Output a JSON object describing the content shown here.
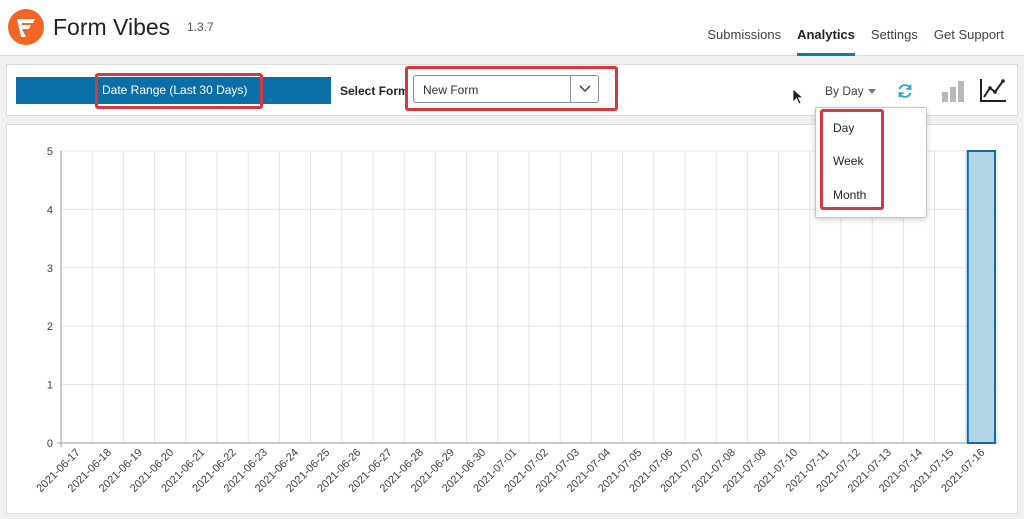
{
  "app": {
    "title": "Form Vibes",
    "version": "1.3.7",
    "logo_icon": "form-vibes-logo-icon",
    "brand_color": "#f26522"
  },
  "nav": {
    "tabs": [
      {
        "label": "Submissions",
        "active": false
      },
      {
        "label": "Analytics",
        "active": true
      },
      {
        "label": "Settings",
        "active": false
      },
      {
        "label": "Get Support",
        "active": false
      }
    ]
  },
  "toolbar": {
    "date_range_label": "Date Range (Last 30 Days)",
    "select_form_label": "Select Form",
    "form_value": "New Form",
    "group_by_label": "By Day",
    "accent_color": "#0b6ea6",
    "highlight_color": "#d7373f"
  },
  "dropdown": {
    "options": [
      "Day",
      "Week",
      "Month"
    ]
  },
  "chart_data": {
    "type": "bar",
    "categories": [
      "2021-06-17",
      "2021-06-18",
      "2021-06-19",
      "2021-06-20",
      "2021-06-21",
      "2021-06-22",
      "2021-06-23",
      "2021-06-24",
      "2021-06-25",
      "2021-06-26",
      "2021-06-27",
      "2021-06-28",
      "2021-06-29",
      "2021-06-30",
      "2021-07-01",
      "2021-07-02",
      "2021-07-03",
      "2021-07-04",
      "2021-07-05",
      "2021-07-06",
      "2021-07-07",
      "2021-07-08",
      "2021-07-09",
      "2021-07-10",
      "2021-07-11",
      "2021-07-12",
      "2021-07-13",
      "2021-07-14",
      "2021-07-15",
      "2021-07-16"
    ],
    "values": [
      0,
      0,
      0,
      0,
      0,
      0,
      0,
      0,
      0,
      0,
      0,
      0,
      0,
      0,
      0,
      0,
      0,
      0,
      0,
      0,
      0,
      0,
      0,
      0,
      0,
      0,
      0,
      0,
      0,
      5
    ],
    "yticks": [
      "0",
      "1",
      "2",
      "3",
      "4",
      "5"
    ],
    "ylim": [
      0,
      5
    ],
    "grid": true,
    "bar_fill": "#b3d4e5",
    "bar_stroke": "#0b6ea6"
  }
}
